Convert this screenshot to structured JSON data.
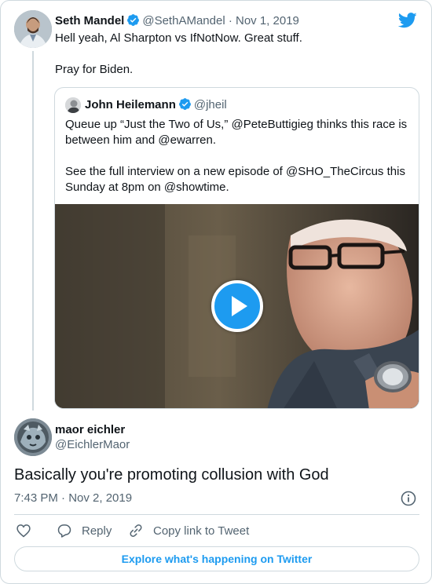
{
  "parent_tweet": {
    "author_name": "Seth Mandel",
    "handle": "@SethAMandel",
    "separator": "·",
    "date": "Nov 1, 2019",
    "text_lines": [
      "Hell yeah, Al Sharpton vs IfNotNow. Great stuff.",
      "Pray for Biden."
    ],
    "verified": true
  },
  "quoted_tweet": {
    "author_name": "John Heilemann",
    "handle": "@jheil",
    "verified": true,
    "paragraphs": [
      "Queue up “Just the Two of Us,” @PeteButtigieg thinks this race is between him and @ewarren.",
      "See the full interview on a new episode of @SHO_TheCircus this Sunday at 8pm on @showtime."
    ],
    "media": {
      "type": "video",
      "play_icon": "play-icon"
    }
  },
  "reply_tweet": {
    "author_name": "maor eichler",
    "handle": "@EichlerMaor",
    "text": "Basically you're promoting collusion with God",
    "timestamp": "7:43 PM · Nov 2, 2019",
    "info_icon": "info-icon"
  },
  "actions": {
    "like_icon": "heart-icon",
    "reply_label": "Reply",
    "reply_icon": "reply-bubble-icon",
    "copy_label": "Copy link to Tweet",
    "copy_icon": "link-icon"
  },
  "explore_label": "Explore what's happening on Twitter",
  "colors": {
    "accent": "#1d9bf0",
    "text": "#0f1419",
    "secondary": "#536471",
    "border": "#cfd9de"
  }
}
